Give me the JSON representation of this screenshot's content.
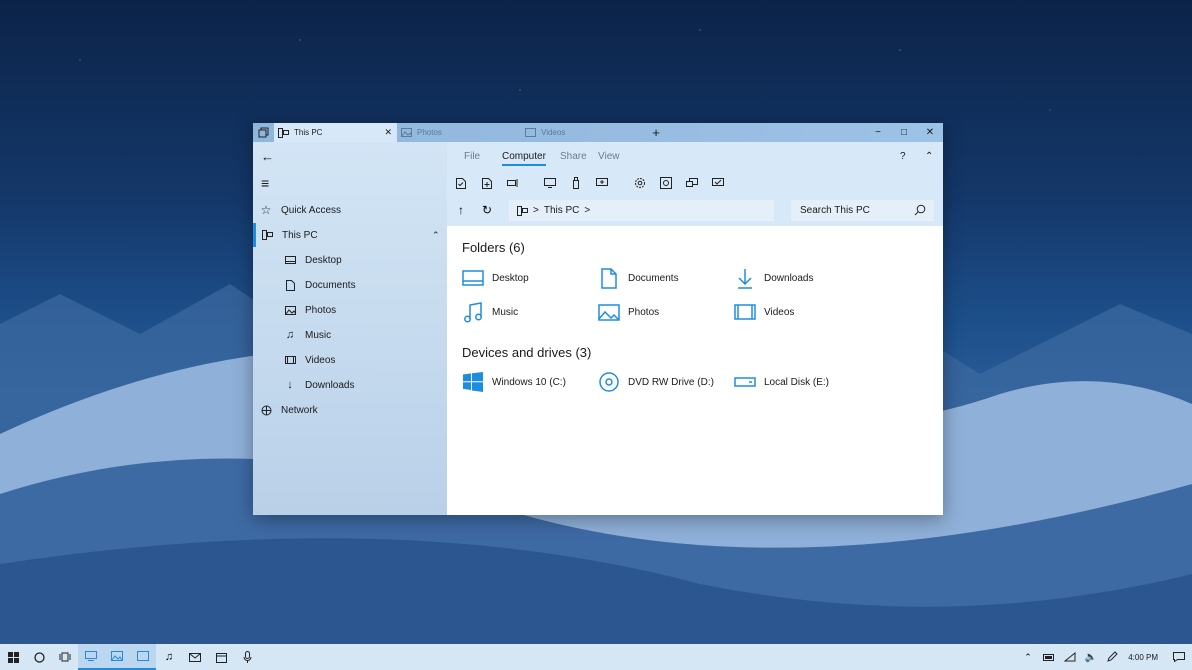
{
  "tabs": [
    {
      "label": "This PC",
      "icon": "this-pc-icon",
      "active": true
    },
    {
      "label": "Photos",
      "icon": "photos-icon",
      "active": false
    },
    {
      "label": "Videos",
      "icon": "videos-icon",
      "active": false
    }
  ],
  "window_controls": {
    "new_tab": "+",
    "minimize": "−",
    "maximize": "□",
    "close": "✕"
  },
  "sidebar": {
    "back": "←",
    "menu": "≡",
    "items": [
      {
        "label": "Quick Access",
        "icon": "star-icon"
      },
      {
        "label": "This PC",
        "icon": "this-pc-icon"
      },
      {
        "label": "Desktop",
        "icon": "desktop-icon"
      },
      {
        "label": "Documents",
        "icon": "document-icon"
      },
      {
        "label": "Photos",
        "icon": "photos-icon"
      },
      {
        "label": "Music",
        "icon": "music-icon"
      },
      {
        "label": "Videos",
        "icon": "videos-icon"
      },
      {
        "label": "Downloads",
        "icon": "download-icon"
      },
      {
        "label": "Network",
        "icon": "network-icon"
      }
    ]
  },
  "ribbon": {
    "menus": [
      "File",
      "Computer",
      "Share",
      "View"
    ],
    "active_menu": "Computer",
    "help": "?",
    "collapse": "⌃"
  },
  "address": {
    "crumb": "This PC",
    "sep": ">"
  },
  "search": {
    "placeholder": "Search This PC"
  },
  "folders": {
    "heading": "Folders (6)",
    "items": [
      {
        "label": "Desktop",
        "icon": "desktop-icon"
      },
      {
        "label": "Documents",
        "icon": "document-icon"
      },
      {
        "label": "Downloads",
        "icon": "download-icon"
      },
      {
        "label": "Music",
        "icon": "music-icon"
      },
      {
        "label": "Photos",
        "icon": "photos-icon"
      },
      {
        "label": "Videos",
        "icon": "videos-icon"
      }
    ]
  },
  "drives": {
    "heading": "Devices and drives (3)",
    "items": [
      {
        "label": "Windows 10 (C:)",
        "icon": "windows-logo-icon"
      },
      {
        "label": "DVD RW Drive (D:)",
        "icon": "dvd-icon"
      },
      {
        "label": "Local Disk (E:)",
        "icon": "disk-icon"
      }
    ]
  },
  "taskbar": {
    "clock": "4:00 PM"
  },
  "colors": {
    "accent": "#1e8de0",
    "ribbon": "#d7e9f8",
    "sidebar": "#c9dcef",
    "taskbar": "#d5e6f5"
  }
}
